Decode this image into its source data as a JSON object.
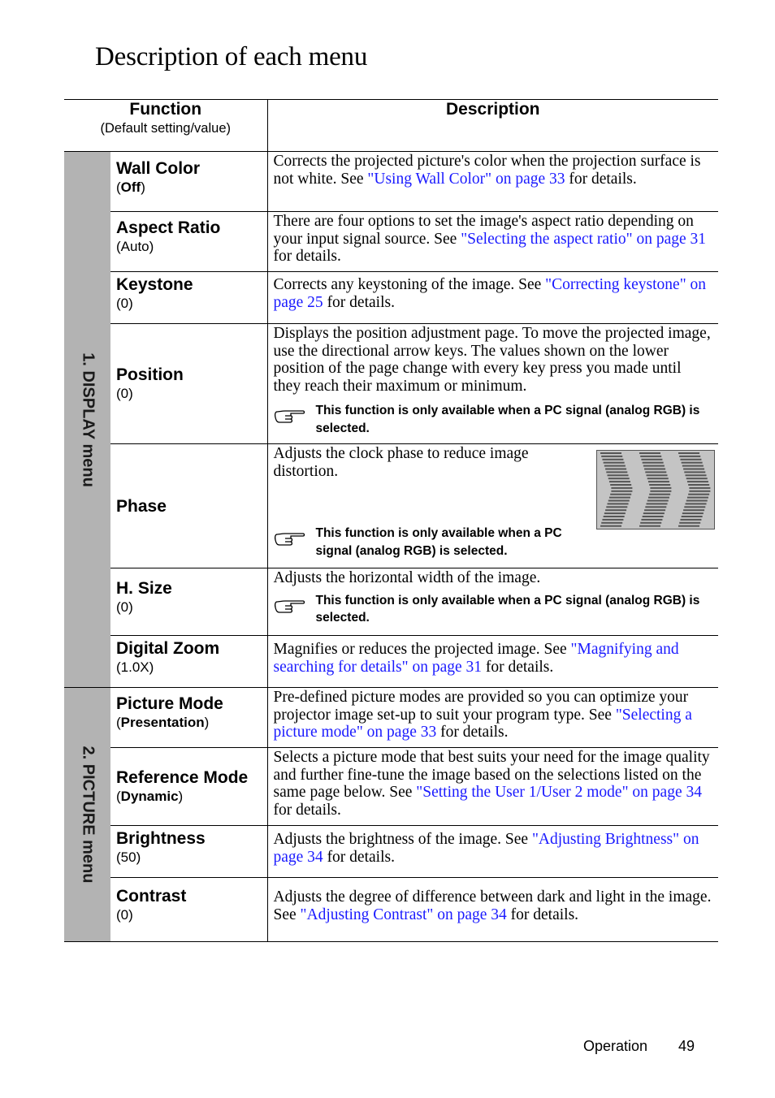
{
  "page": {
    "title": "Description of each menu",
    "footer": {
      "section": "Operation",
      "page_number": "49"
    }
  },
  "table": {
    "header": {
      "function": "Function",
      "function_sub": "(Default setting/value)",
      "description": "Description"
    },
    "sections": [
      {
        "label": "1. DISPLAY menu"
      },
      {
        "label": "2. PICTURE menu"
      }
    ],
    "rows": [
      {
        "name": "Wall Color",
        "default_open": " (",
        "default": "Off",
        "default_close": ")",
        "default_bold": true,
        "desc": [
          "Corrects the projected picture's color when the projection surface is not white. See ",
          "\"Using Wall Color\" on page 33",
          " for details."
        ]
      },
      {
        "name": "Aspect Ratio",
        "default": "(Auto)",
        "desc": [
          "There are four options to set the image's aspect ratio depending on your input signal source. See ",
          "\"Selecting the aspect ratio\" on page 31",
          " for details."
        ]
      },
      {
        "name": "Keystone",
        "default": "(0)",
        "desc": [
          "Corrects any keystoning of the image. See ",
          "\"Correcting keystone\" on page 25",
          " for details."
        ]
      },
      {
        "name": "Position",
        "default": "(0)",
        "desc": [
          "Displays the position adjustment page. To move the projected image, use the directional arrow keys. The values shown on the lower position of the page change with every key press you made until they reach their maximum or minimum."
        ],
        "note": "This function is only available when a PC signal (analog RGB) is selected."
      },
      {
        "name": "Phase",
        "desc": [
          "Adjusts the clock phase to reduce image distortion."
        ],
        "note": "This function is only available when a PC signal (analog RGB) is selected.",
        "image": "phase-distortion-pattern"
      },
      {
        "name": "H. Size",
        "default": "(0)",
        "desc": [
          "Adjusts the horizontal width of the image."
        ],
        "note": "This function is only available when a PC signal (analog RGB) is selected."
      },
      {
        "name": "Digital Zoom",
        "default": "(1.0X)",
        "desc": [
          "Magnifies or reduces the projected image. See ",
          "\"Magnifying and searching for details\" on page 31",
          " for details."
        ]
      },
      {
        "name": "Picture Mode",
        "default_open": "(",
        "default": "Presentation",
        "default_close": ")",
        "default_bold": true,
        "desc": [
          "Pre-defined picture modes are provided so you can optimize your projector image set-up to suit your program type. See ",
          "\"Selecting a picture mode\" on page 33",
          " for details."
        ]
      },
      {
        "name": "Reference Mode",
        "default_open": "(",
        "default": "Dynamic",
        "default_close": ")",
        "default_bold": true,
        "desc": [
          "Selects a picture mode that best suits your need for the image quality and further fine-tune the image based on the selections listed on the same page below. See ",
          "\"Setting the User 1/User 2 mode\" on page 34",
          " for details."
        ]
      },
      {
        "name": "Brightness",
        "default": "(50)",
        "desc": [
          "Adjusts the brightness of the image. See ",
          "\"Adjusting Brightness\" on page 34",
          " for details."
        ]
      },
      {
        "name": "Contrast",
        "default": "(0)",
        "desc": [
          "Adjusts the degree of difference between dark and light in the image. See ",
          "\"Adjusting Contrast\" on page 34",
          " for details."
        ]
      }
    ]
  },
  "icons": {
    "note": "pointing-hand-icon"
  },
  "colors": {
    "link": "#1a1aff",
    "section_bg": "#b3b3b3"
  }
}
